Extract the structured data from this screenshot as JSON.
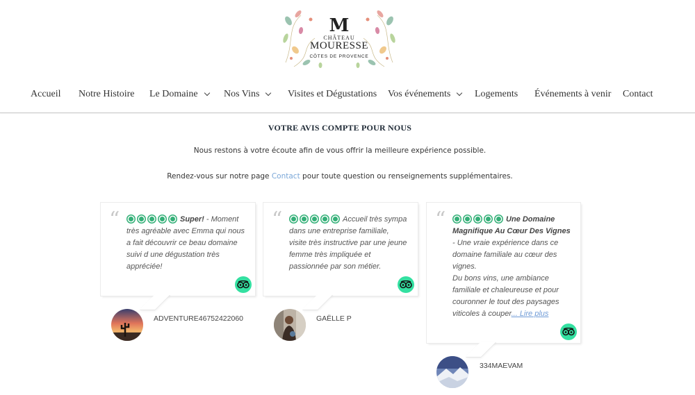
{
  "logo": {
    "monogram": "M",
    "chateau": "CHÂTEAU",
    "name": "MOURESSE",
    "region": "CÔTES DE PROVENCE"
  },
  "nav": {
    "items": [
      {
        "label": "Accueil",
        "dropdown": false
      },
      {
        "label": "Notre Histoire",
        "dropdown": false
      },
      {
        "label": "Le Domaine",
        "dropdown": true
      },
      {
        "label": "Nos Vins",
        "dropdown": true
      },
      {
        "label": "Visites et Dégustations",
        "dropdown": false
      },
      {
        "label": "Vos événements",
        "dropdown": true
      },
      {
        "label": "Logements",
        "dropdown": false
      },
      {
        "label": "Événements à venir",
        "dropdown": false
      },
      {
        "label": "Contact",
        "dropdown": false
      }
    ]
  },
  "section": {
    "title": "VOTRE AVIS COMPTE POUR NOUS",
    "intro1": "Nous restons à votre écoute afin de vous offrir la meilleure expérience possible.",
    "intro2_before": "Rendez-vous sur notre page ",
    "intro2_link": "Contact",
    "intro2_after": " pour toute question ou renseignements supplémentaires."
  },
  "reviews": [
    {
      "rating": 5,
      "title": "Super!",
      "separator": " - ",
      "text": "Moment très agréable avec Emma qui nous a fait découvrir ce beau domaine suivi d une dégustation très appréciée!",
      "author": "ADVENTURE46752422060",
      "readmore": ""
    },
    {
      "rating": 5,
      "title": "",
      "separator": "",
      "text": "Accueil très sympa dans une entreprise familiale, visite très instructive par une jeune femme très impliquée et passionnée par son métier.",
      "author": "GAËLLE P",
      "readmore": ""
    },
    {
      "rating": 5,
      "title": "Une Domaine Magnifique Au Cœur Des Vignes",
      "separator": "",
      "text": " - Une vraie expérience dans ce domaine familiale au cœur des vignes.",
      "text2": "Du bons vins, une ambiance familiale et chaleureuse et pour couronner le tout des paysages viticoles à couper",
      "author": "334MAEVAM",
      "readmore": "... Lire plus"
    }
  ],
  "colors": {
    "accent_green": "#34b078",
    "tripadvisor_badge": "#34e0a1",
    "link_blue": "#7aa7d8",
    "title_navy": "#1f2a36"
  },
  "icons": {
    "review_source": "tripadvisor-owl-icon",
    "quote": "quote-mark-icon",
    "dropdown": "chevron-down-icon"
  }
}
